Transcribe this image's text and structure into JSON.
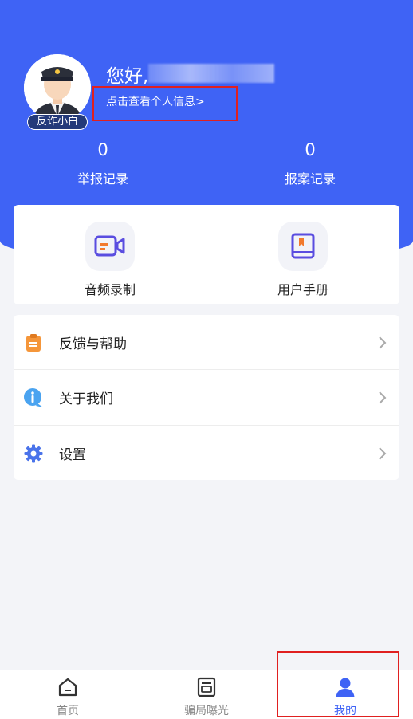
{
  "user": {
    "greeting": "您好,",
    "profile_link": "点击查看个人信息>",
    "badge": "反诈小白"
  },
  "stats": [
    {
      "value": "0",
      "label": "举报记录"
    },
    {
      "value": "0",
      "label": "报案记录"
    }
  ],
  "tools": [
    {
      "label": "音频录制",
      "icon": "video-record-icon"
    },
    {
      "label": "用户手册",
      "icon": "book-icon"
    }
  ],
  "menu": [
    {
      "label": "反馈与帮助",
      "icon": "clipboard-icon"
    },
    {
      "label": "关于我们",
      "icon": "info-icon"
    },
    {
      "label": "设置",
      "icon": "gear-icon"
    }
  ],
  "tabbar": [
    {
      "label": "首页",
      "icon": "home-icon",
      "active": false
    },
    {
      "label": "骗局曝光",
      "icon": "newspaper-icon",
      "active": false
    },
    {
      "label": "我的",
      "icon": "user-icon",
      "active": true
    }
  ],
  "colors": {
    "primary": "#3f63f5",
    "highlight": "#e02020",
    "background": "#f3f4f8"
  }
}
